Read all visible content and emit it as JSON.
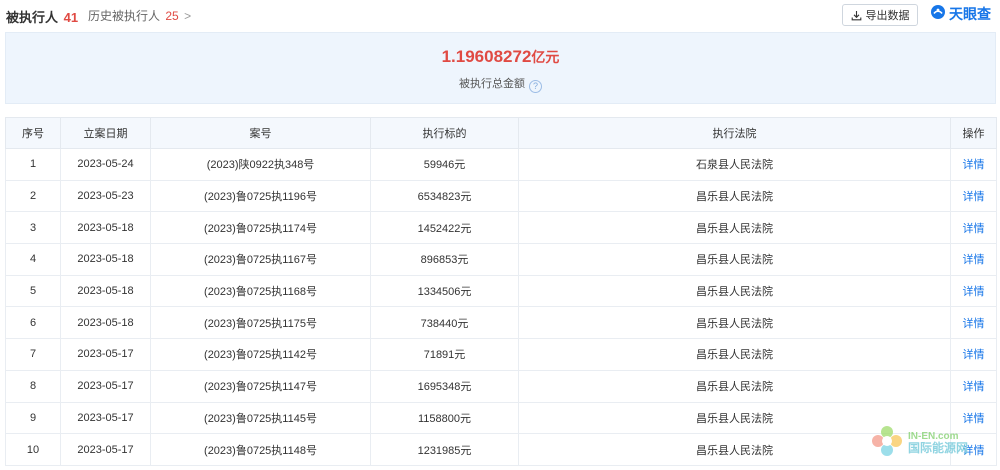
{
  "tabs": {
    "current_label": "被执行人",
    "current_count": "41",
    "history_label": "历史被执行人",
    "history_count": "25",
    "history_chevron": ">"
  },
  "toolbar": {
    "export_label": "导出数据"
  },
  "brand": {
    "name": "天眼查",
    "color": "#1776e8"
  },
  "summary": {
    "amount": "1.19608272",
    "unit": "亿元",
    "label": "被执行总金额",
    "help_glyph": "?"
  },
  "table": {
    "headers": [
      "序号",
      "立案日期",
      "案号",
      "执行标的",
      "执行法院",
      "操作"
    ],
    "rows": [
      {
        "index": "1",
        "date": "2023-05-24",
        "case": "(2023)陕0922执348号",
        "amount": "59946元",
        "court": "石泉县人民法院",
        "action": "详情"
      },
      {
        "index": "2",
        "date": "2023-05-23",
        "case": "(2023)鲁0725执1196号",
        "amount": "6534823元",
        "court": "昌乐县人民法院",
        "action": "详情"
      },
      {
        "index": "3",
        "date": "2023-05-18",
        "case": "(2023)鲁0725执1174号",
        "amount": "1452422元",
        "court": "昌乐县人民法院",
        "action": "详情"
      },
      {
        "index": "4",
        "date": "2023-05-18",
        "case": "(2023)鲁0725执1167号",
        "amount": "896853元",
        "court": "昌乐县人民法院",
        "action": "详情"
      },
      {
        "index": "5",
        "date": "2023-05-18",
        "case": "(2023)鲁0725执1168号",
        "amount": "1334506元",
        "court": "昌乐县人民法院",
        "action": "详情"
      },
      {
        "index": "6",
        "date": "2023-05-18",
        "case": "(2023)鲁0725执1175号",
        "amount": "738440元",
        "court": "昌乐县人民法院",
        "action": "详情"
      },
      {
        "index": "7",
        "date": "2023-05-17",
        "case": "(2023)鲁0725执1142号",
        "amount": "71891元",
        "court": "昌乐县人民法院",
        "action": "详情"
      },
      {
        "index": "8",
        "date": "2023-05-17",
        "case": "(2023)鲁0725执1147号",
        "amount": "1695348元",
        "court": "昌乐县人民法院",
        "action": "详情"
      },
      {
        "index": "9",
        "date": "2023-05-17",
        "case": "(2023)鲁0725执1145号",
        "amount": "1158800元",
        "court": "昌乐县人民法院",
        "action": "详情"
      },
      {
        "index": "10",
        "date": "2023-05-17",
        "case": "(2023)鲁0725执1148号",
        "amount": "1231985元",
        "court": "昌乐县人民法院",
        "action": "详情"
      }
    ]
  },
  "watermark": {
    "line1": "IN-EN.com",
    "line2": "国际能源网"
  },
  "colors": {
    "accent_red": "#e04a43",
    "link_blue": "#1776e8",
    "summary_bg": "#eef5fd"
  }
}
